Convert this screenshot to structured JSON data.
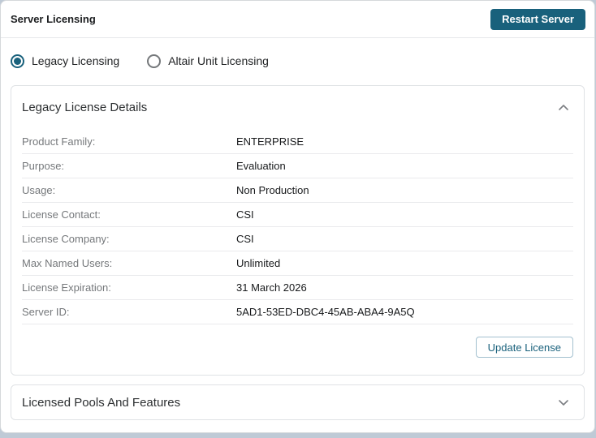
{
  "header": {
    "title": "Server Licensing",
    "restart_button": "Restart Server"
  },
  "licensing_mode": {
    "options": [
      {
        "label": "Legacy Licensing",
        "selected": true
      },
      {
        "label": "Altair Unit Licensing",
        "selected": false
      }
    ]
  },
  "legacy_details": {
    "title": "Legacy License Details",
    "expanded": true,
    "rows": [
      {
        "label": "Product Family:",
        "value": "ENTERPRISE"
      },
      {
        "label": "Purpose:",
        "value": "Evaluation"
      },
      {
        "label": "Usage:",
        "value": "Non Production"
      },
      {
        "label": "License Contact:",
        "value": "CSI"
      },
      {
        "label": "License Company:",
        "value": "CSI"
      },
      {
        "label": "Max Named Users:",
        "value": "Unlimited"
      },
      {
        "label": "License Expiration:",
        "value": "31 March 2026"
      },
      {
        "label": "Server ID:",
        "value": "5AD1-53ED-DBC4-45AB-ABA4-9A5Q"
      }
    ],
    "update_button": "Update License"
  },
  "pools_section": {
    "title": "Licensed Pools And Features",
    "expanded": false
  },
  "icons": {
    "legacy_details_chevron": "chevron-up",
    "pools_chevron": "chevron-down"
  },
  "colors": {
    "accent_teal": "#19617c",
    "label_gray": "#75787b",
    "value_dark": "#17191b",
    "divider": "#e9eaec"
  }
}
